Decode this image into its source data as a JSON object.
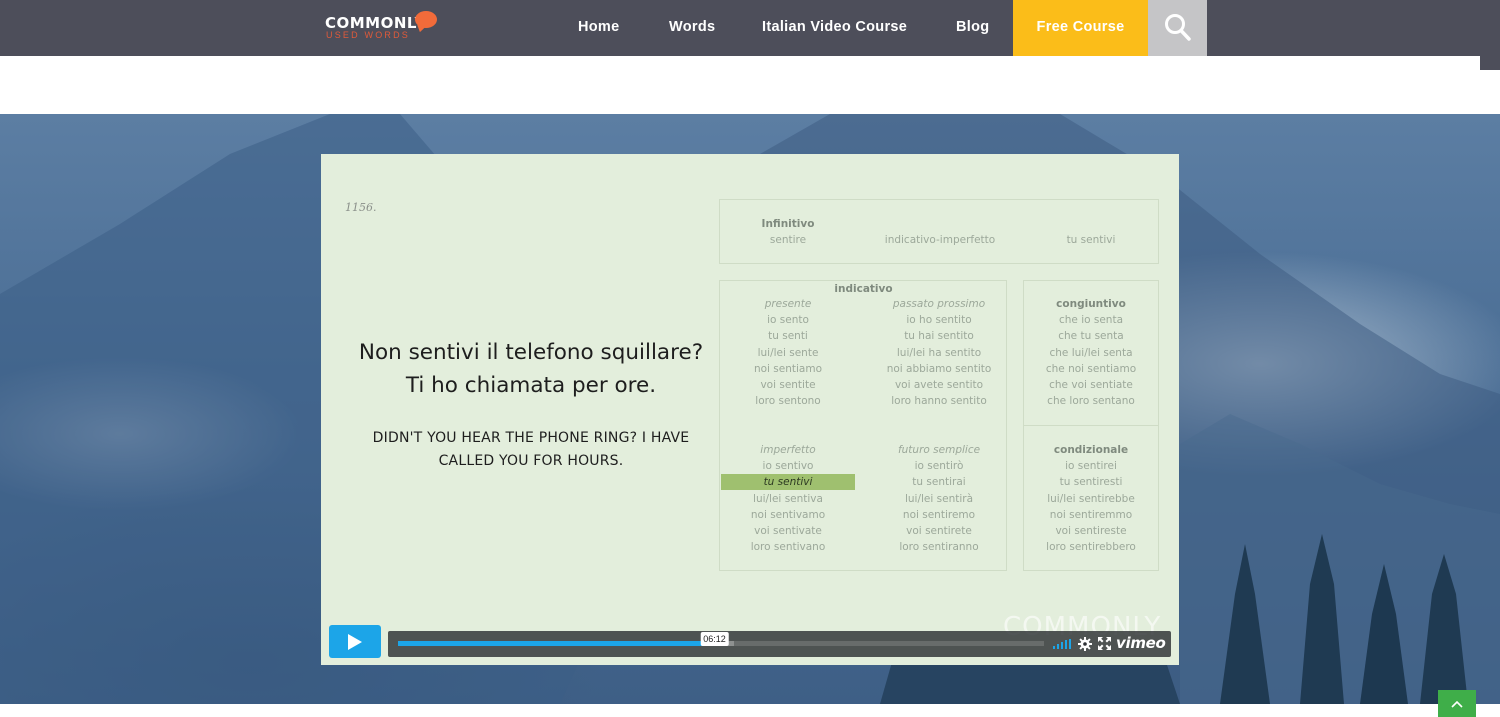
{
  "nav": {
    "logo_main": "COMMONLY",
    "logo_sub": "USED WORDS",
    "items": [
      {
        "label": "Home"
      },
      {
        "label": "Words"
      },
      {
        "label": "Italian Video Course"
      },
      {
        "label": "Blog"
      }
    ],
    "cta": "Free Course",
    "search_icon": "search-icon"
  },
  "slide": {
    "number": "1156.",
    "sentence_line1": "Non sentivi il telefono squillare?",
    "sentence_line2": "Ti ho chiamata per ore.",
    "translation_line1": "DIDN'T YOU HEAR THE PHONE RING? I HAVE",
    "translation_line2": "CALLED YOU FOR HOURS.",
    "header": {
      "infinitive_label": "Infinitivo",
      "infinitive": "sentire",
      "tense": "indicativo-imperfetto",
      "form": "tu sentivi"
    },
    "indicativo_title": "indicativo",
    "presente": {
      "title": "presente",
      "forms": [
        "io sento",
        "tu senti",
        "lui/lei sente",
        "noi sentiamo",
        "voi sentite",
        "loro sentono"
      ]
    },
    "passato_prossimo": {
      "title": "passato prossimo",
      "forms": [
        "io ho sentito",
        "tu hai sentito",
        "lui/lei ha sentito",
        "noi abbiamo sentito",
        "voi avete sentito",
        "loro hanno sentito"
      ]
    },
    "imperfetto": {
      "title": "imperfetto",
      "forms": [
        "io sentivo",
        "tu sentivi",
        "lui/lei sentiva",
        "noi sentivamo",
        "voi sentivate",
        "loro sentivano"
      ]
    },
    "futuro_semplice": {
      "title": "futuro semplice",
      "forms": [
        "io sentirò",
        "tu sentirai",
        "lui/lei sentirà",
        "noi sentiremo",
        "voi sentirete",
        "loro sentiranno"
      ]
    },
    "congiuntivo": {
      "title": "congiuntivo",
      "forms": [
        "che io senta",
        "che tu senta",
        "che lui/lei senta",
        "che noi sentiamo",
        "che voi sentiate",
        "che loro sentano"
      ]
    },
    "condizionale": {
      "title": "condizionale",
      "forms": [
        "io sentirei",
        "tu sentiresti",
        "lui/lei sentirebbe",
        "noi sentiremmo",
        "voi sentireste",
        "loro sentirebbero"
      ]
    },
    "watermark": "COMMONLY"
  },
  "player": {
    "current_time": "06:12",
    "progress": 0.49,
    "buffered": 0.52,
    "logo": "vimeo",
    "accent": "#1ca5e8",
    "play_icon": "play-icon",
    "volume_icon": "volume-icon",
    "settings_icon": "gear-icon",
    "fullscreen_icon": "fullscreen-icon"
  },
  "back_to_top_icon": "chevron-up-icon",
  "colors": {
    "nav_bg": "#4d4e5a",
    "cta_bg": "#fbbd19",
    "search_bg": "#c5c5c7",
    "highlight": "#9fc06f",
    "back_to_top": "#3fae49"
  }
}
